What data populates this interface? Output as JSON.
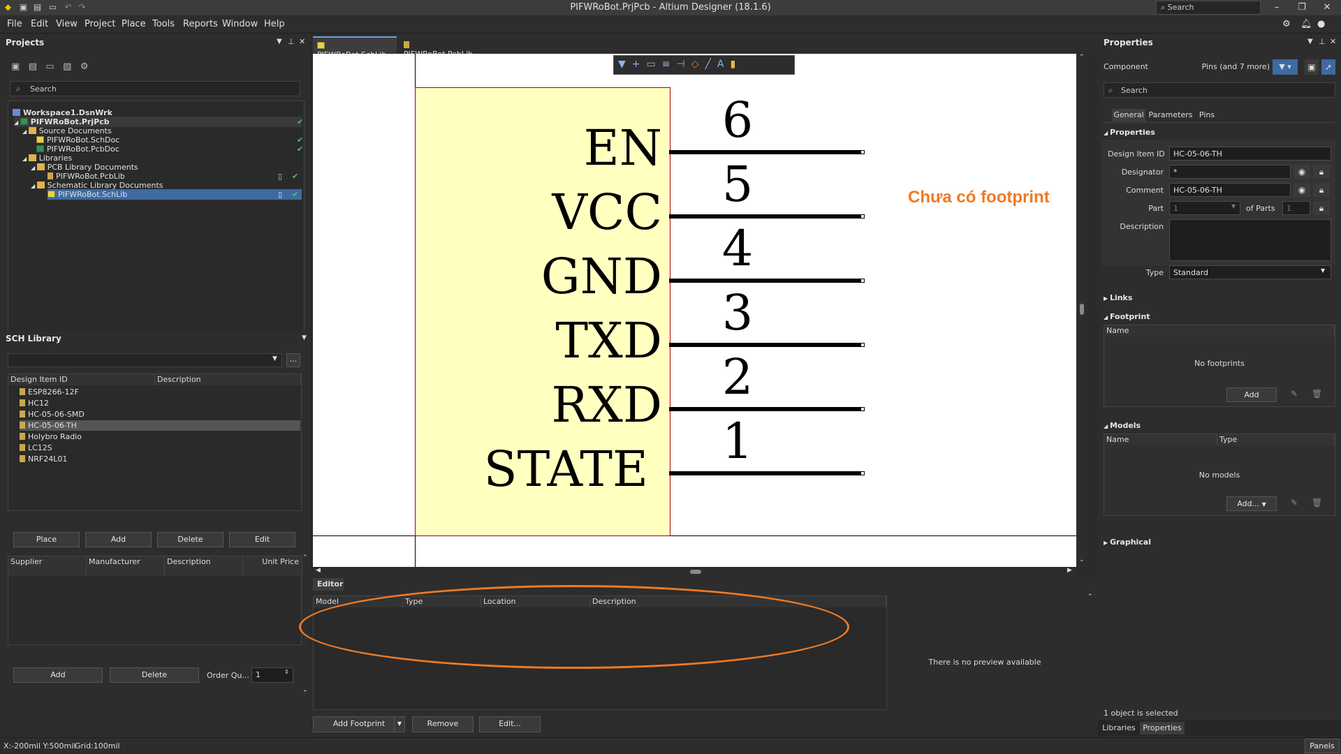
{
  "window": {
    "title": "PIFWRoBot.PrjPcb - Altium Designer (18.1.6)",
    "search_label": "Search"
  },
  "menu": [
    "File",
    "Edit",
    "View",
    "Project",
    "Place",
    "Tools",
    "Reports",
    "Window",
    "Help"
  ],
  "projects_panel": {
    "title": "Projects",
    "search_placeholder": "Search",
    "tree": [
      {
        "label": "Workspace1.DsnWrk",
        "icon": "workspace-icon",
        "indent": 0
      },
      {
        "label": "PIFWRoBot.PrjPcb",
        "icon": "pcb-project-icon",
        "indent": 1,
        "check": true,
        "bold": true
      },
      {
        "label": "Source Documents",
        "icon": "folder-icon",
        "indent": 2
      },
      {
        "label": "PIFWRoBot.SchDoc",
        "icon": "schematic-doc-icon",
        "indent": 3,
        "check": true
      },
      {
        "label": "PIFWRoBot.PcbDoc",
        "icon": "pcb-doc-icon",
        "indent": 3,
        "check": true
      },
      {
        "label": "Libraries",
        "icon": "folder-icon",
        "indent": 2
      },
      {
        "label": "PCB Library Documents",
        "icon": "folder-icon",
        "indent": 3
      },
      {
        "label": "PIFWRoBot.PcbLib",
        "icon": "pcb-lib-icon",
        "indent": 4,
        "check": true,
        "doc": true
      },
      {
        "label": "Schematic Library Documents",
        "icon": "folder-icon",
        "indent": 3
      },
      {
        "label": "PIFWRoBot.SchLib",
        "icon": "sch-lib-icon",
        "indent": 4,
        "check": true,
        "doc": true,
        "selected": true
      }
    ]
  },
  "sch_library": {
    "title": "SCH Library",
    "columns": [
      "Design Item ID",
      "Description"
    ],
    "items": [
      "ESP8266-12F",
      "HC12",
      "HC-05-06-SMD",
      "HC-05-06-TH",
      "Holybro Radio",
      "LC12S",
      "NRF24L01"
    ],
    "selected": "HC-05-06-TH",
    "buttons": [
      "Place",
      "Add",
      "Delete",
      "Edit"
    ],
    "supplier_columns": [
      "Supplier",
      "Manufacturer",
      "Description",
      "Unit Price"
    ],
    "bottom_buttons": [
      "Add",
      "Delete"
    ],
    "order_label": "Order Qu...",
    "order_value": "1"
  },
  "tabs": [
    "PIFWRoBot.SchLib",
    "PIFWRoBot.PcbLib"
  ],
  "component": {
    "pins": [
      {
        "name": "EN",
        "number": "6"
      },
      {
        "name": "VCC",
        "number": "5"
      },
      {
        "name": "GND",
        "number": "4"
      },
      {
        "name": "TXD",
        "number": "3"
      },
      {
        "name": "RXD",
        "number": "2"
      },
      {
        "name": "STATE",
        "number": "1"
      }
    ],
    "annotation": "Chưa có footprint"
  },
  "editor": {
    "tab": "Editor",
    "columns": [
      "Model",
      "Type",
      "Location",
      "Description"
    ],
    "preview_text": "There is no preview available",
    "buttons": [
      "Add Footprint",
      "Remove",
      "Edit..."
    ]
  },
  "properties": {
    "title": "Properties",
    "component_label": "Component",
    "filter_text": "Pins (and 7 more)",
    "search_placeholder": "Search",
    "tabs": [
      "General",
      "Parameters",
      "Pins"
    ],
    "section_properties": "Properties",
    "design_item_id_label": "Design Item ID",
    "design_item_id": "HC-05-06-TH",
    "designator_label": "Designator",
    "designator": "*",
    "comment_label": "Comment",
    "comment": "HC-05-06-TH",
    "part_label": "Part",
    "part_value": "1",
    "of_parts_label": "of Parts",
    "of_parts_value": "1",
    "description_label": "Description",
    "type_label": "Type",
    "type_value": "Standard",
    "links": "Links",
    "footprint": "Footprint",
    "fp_col": "Name",
    "no_footprints": "No footprints",
    "fp_add": "Add",
    "models": "Models",
    "models_cols": [
      "Name",
      "Type"
    ],
    "no_models": "No models",
    "models_add": "Add...",
    "graphical": "Graphical",
    "status": "1 object is selected",
    "bottom_tabs": [
      "Libraries",
      "Properties"
    ]
  },
  "status_bar": {
    "coords": "X:-200mil Y:500mil",
    "grid": "Grid:100mil",
    "panels": "Panels"
  },
  "colors": {
    "component_fill": "#ffffc0",
    "annotation": "#f07a22",
    "selection": "#3e6aa3"
  }
}
